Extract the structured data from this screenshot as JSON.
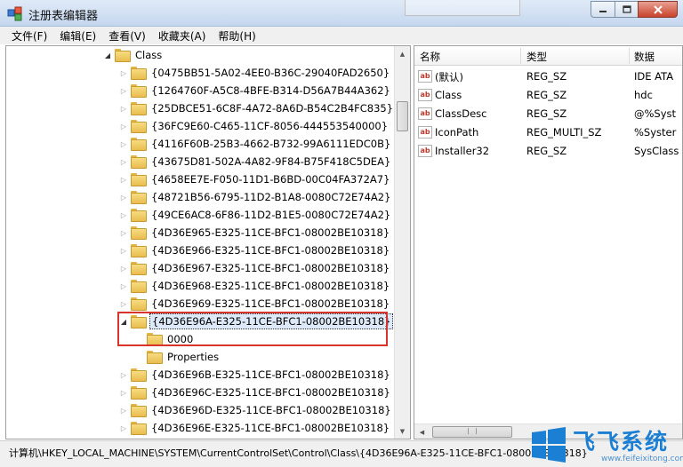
{
  "window": {
    "title": "注册表编辑器",
    "icon": "regedit-icon"
  },
  "menu": [
    "文件(F)",
    "编辑(E)",
    "查看(V)",
    "收藏夹(A)",
    "帮助(H)"
  ],
  "tree": {
    "parent_label": "Class",
    "items": [
      {
        "label": "{0475BB51-5A02-4EE0-B36C-29040FAD2650}"
      },
      {
        "label": "{1264760F-A5C8-4BFE-B314-D56A7B44A362}"
      },
      {
        "label": "{25DBCE51-6C8F-4A72-8A6D-B54C2B4FC835}"
      },
      {
        "label": "{36FC9E60-C465-11CF-8056-444553540000}"
      },
      {
        "label": "{4116F60B-25B3-4662-B732-99A6111EDC0B}"
      },
      {
        "label": "{43675D81-502A-4A82-9F84-B75F418C5DEA}"
      },
      {
        "label": "{4658EE7E-F050-11D1-B6BD-00C04FA372A7}"
      },
      {
        "label": "{48721B56-6795-11D2-B1A8-0080C72E74A2}"
      },
      {
        "label": "{49CE6AC8-6F86-11D2-B1E5-0080C72E74A2}"
      },
      {
        "label": "{4D36E965-E325-11CE-BFC1-08002BE10318}"
      },
      {
        "label": "{4D36E966-E325-11CE-BFC1-08002BE10318}"
      },
      {
        "label": "{4D36E967-E325-11CE-BFC1-08002BE10318}"
      },
      {
        "label": "{4D36E968-E325-11CE-BFC1-08002BE10318}"
      },
      {
        "label": "{4D36E969-E325-11CE-BFC1-08002BE10318}"
      },
      {
        "label": "{4D36E96A-E325-11CE-BFC1-08002BE10318}"
      },
      {
        "label": "0000"
      },
      {
        "label": "Properties"
      },
      {
        "label": "{4D36E96B-E325-11CE-BFC1-08002BE10318}"
      },
      {
        "label": "{4D36E96C-E325-11CE-BFC1-08002BE10318}"
      },
      {
        "label": "{4D36E96D-E325-11CE-BFC1-08002BE10318}"
      },
      {
        "label": "{4D36E96E-E325-11CE-BFC1-08002BE10318}"
      }
    ]
  },
  "list": {
    "headers": {
      "name": "名称",
      "type": "类型",
      "data": "数据"
    },
    "rows": [
      {
        "name": "(默认)",
        "type": "REG_SZ",
        "data": "IDE ATA"
      },
      {
        "name": "Class",
        "type": "REG_SZ",
        "data": "hdc"
      },
      {
        "name": "ClassDesc",
        "type": "REG_SZ",
        "data": "@%Syst"
      },
      {
        "name": "IconPath",
        "type": "REG_MULTI_SZ",
        "data": "%Syster"
      },
      {
        "name": "Installer32",
        "type": "REG_SZ",
        "data": "SysClass"
      }
    ]
  },
  "status": {
    "path": "计算机\\HKEY_LOCAL_MACHINE\\SYSTEM\\CurrentControlSet\\Control\\Class\\{4D36E96A-E325-11CE-BFC1-08002BE10318}"
  },
  "watermark": {
    "title": "飞飞系统",
    "url": "www.feifeixitong.com"
  },
  "colors": {
    "highlight_box": "#d9342b",
    "folder": "#f0c95e",
    "watermark": "#1b7fd4"
  }
}
